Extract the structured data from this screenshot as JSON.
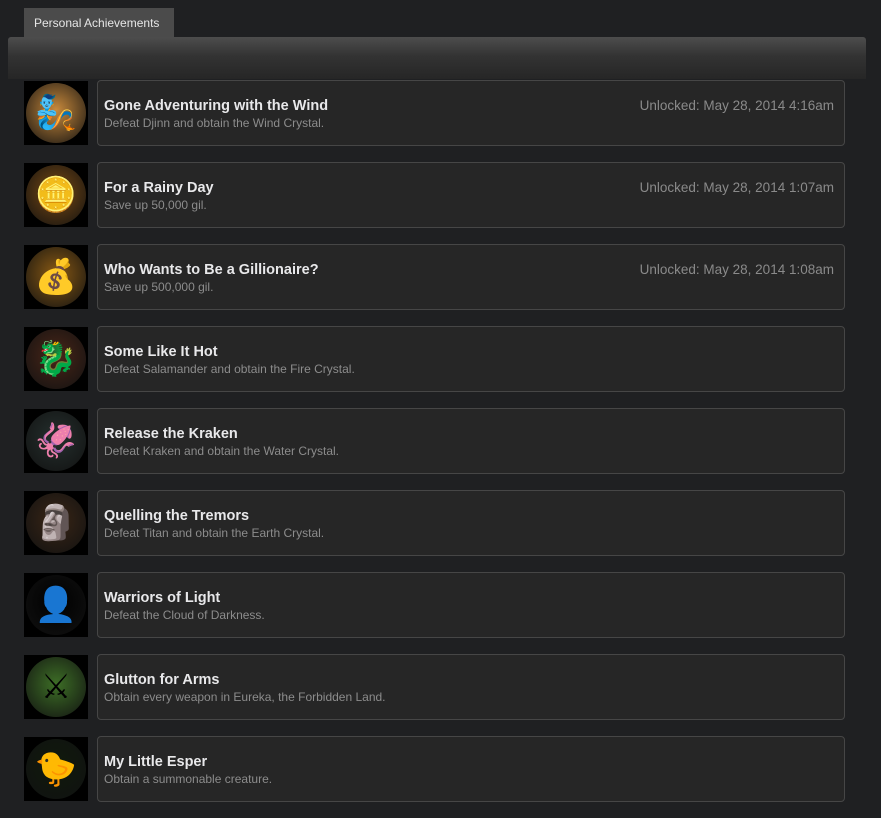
{
  "tab": {
    "label": "Personal Achievements"
  },
  "achievements": [
    {
      "title": "Gone Adventuring with the Wind",
      "description": "Defeat Djinn and obtain the Wind Crystal.",
      "unlocked": "Unlocked: May 28, 2014 4:16am",
      "icon": "djinn-icon",
      "glyph": "🧞",
      "color": "#c98a3c"
    },
    {
      "title": "For a Rainy Day",
      "description": "Save up 50,000 gil.",
      "unlocked": "Unlocked: May 28, 2014 1:07am",
      "icon": "gil-coins-icon",
      "glyph": "🪙",
      "color": "#7a4a12"
    },
    {
      "title": "Who Wants to Be a Gillionaire?",
      "description": "Save up 500,000 gil.",
      "unlocked": "Unlocked: May 28, 2014 1:08am",
      "icon": "gil-pile-icon",
      "glyph": "💰",
      "color": "#8a5a14"
    },
    {
      "title": "Some Like It Hot",
      "description": "Defeat Salamander and obtain the Fire Crystal.",
      "unlocked": "",
      "icon": "salamander-icon",
      "glyph": "🐉",
      "color": "#4a2618"
    },
    {
      "title": "Release the Kraken",
      "description": "Defeat Kraken and obtain the Water Crystal.",
      "unlocked": "",
      "icon": "kraken-icon",
      "glyph": "🦑",
      "color": "#25302e"
    },
    {
      "title": "Quelling the Tremors",
      "description": "Defeat Titan and obtain the Earth Crystal.",
      "unlocked": "",
      "icon": "titan-icon",
      "glyph": "🗿",
      "color": "#3a2616"
    },
    {
      "title": "Warriors of Light",
      "description": "Defeat the Cloud of Darkness.",
      "unlocked": "",
      "icon": "cloud-of-darkness-icon",
      "glyph": "👤",
      "color": "#000000"
    },
    {
      "title": "Glutton for Arms",
      "description": "Obtain every weapon in Eureka, the Forbidden Land.",
      "unlocked": "",
      "icon": "weapons-grid-icon",
      "glyph": "⚔",
      "color": "#3d6e26"
    },
    {
      "title": "My Little Esper",
      "description": "Obtain a summonable creature.",
      "unlocked": "",
      "icon": "chocobo-icon",
      "glyph": "🐤",
      "color": "#0f1a0c"
    }
  ]
}
